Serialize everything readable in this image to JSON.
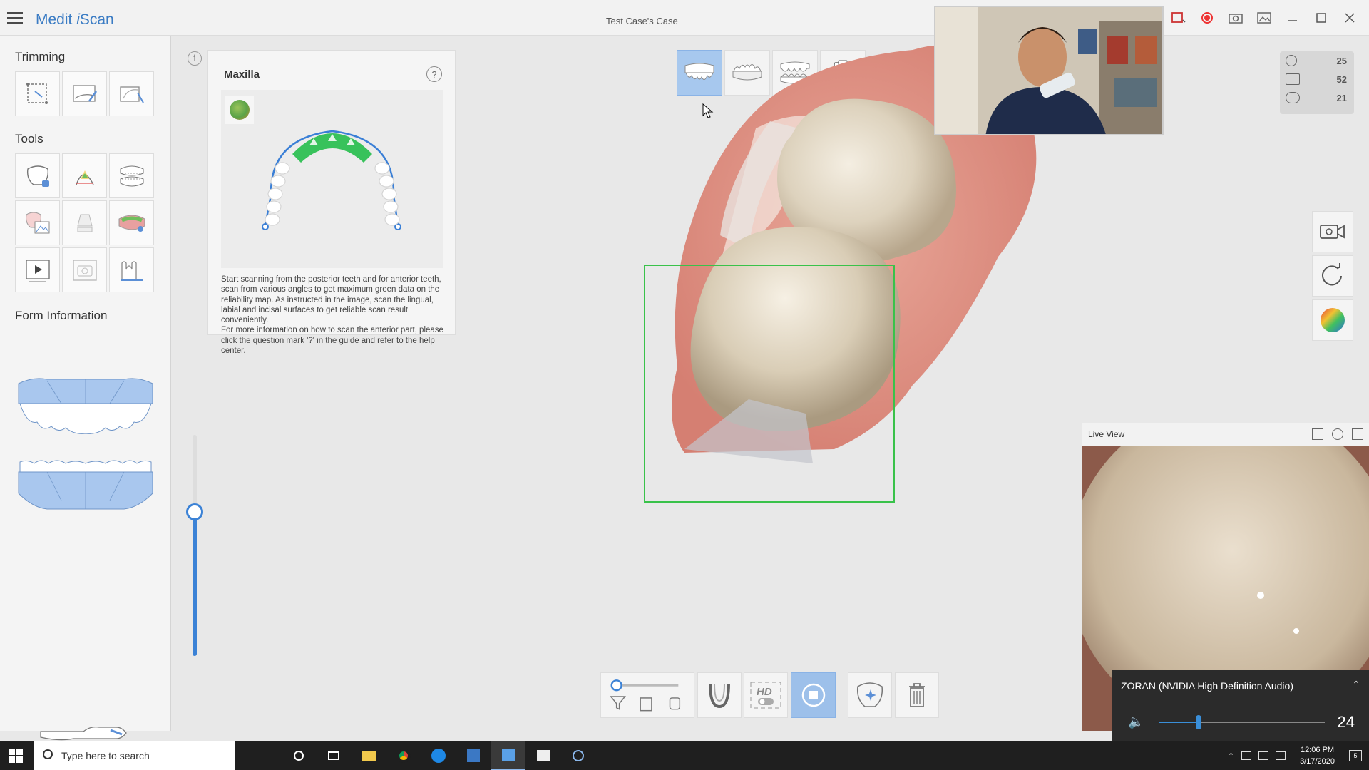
{
  "app": {
    "logo_main": "Medit",
    "logo_italic": "i",
    "logo_tail": "Scan",
    "window_title": "Test Case's Case"
  },
  "sidebar": {
    "trimming_title": "Trimming",
    "tools_title": "Tools",
    "form_title": "Form Information",
    "trimming_tools": [
      "lasso-trim-icon",
      "smart-trim-icon",
      "brush-trim-icon"
    ],
    "tools": [
      "tooth-lock-icon",
      "margin-icon",
      "occlusion-icon",
      "tooth-image-icon",
      "abutment-icon",
      "reliability-icon",
      "play-video-icon",
      "snapshot-icon",
      "measure-icon"
    ]
  },
  "guide": {
    "title": "Maxilla",
    "help": "?",
    "info": "i",
    "text": "Start scanning from the posterior teeth and for anterior teeth, scan from various angles to get maximum green data on the reliability map. As instructed in the image, scan the lingual, labial and incisal surfaces to get reliable scan result conveniently.\nFor more information on how to scan the anterior part, please click the question mark '?' in the guide and refer to the help center."
  },
  "stats": [
    {
      "icon": "timer-icon",
      "value": "25"
    },
    {
      "icon": "frames-icon",
      "value": "52"
    },
    {
      "icon": "rotation-icon",
      "value": "21"
    }
  ],
  "live_view": {
    "title": "Live View"
  },
  "volume": {
    "device": "ZORAN (NVIDIA High Definition Audio)",
    "level": 24,
    "level_text": "24"
  },
  "taskbar": {
    "search_placeholder": "Type here to search",
    "time": "12:06 PM",
    "date": "3/17/2020",
    "notifications": "5"
  },
  "colors": {
    "accent": "#3b82d6",
    "active_button": "#9dc0ea",
    "scan_box": "#39c24a"
  }
}
